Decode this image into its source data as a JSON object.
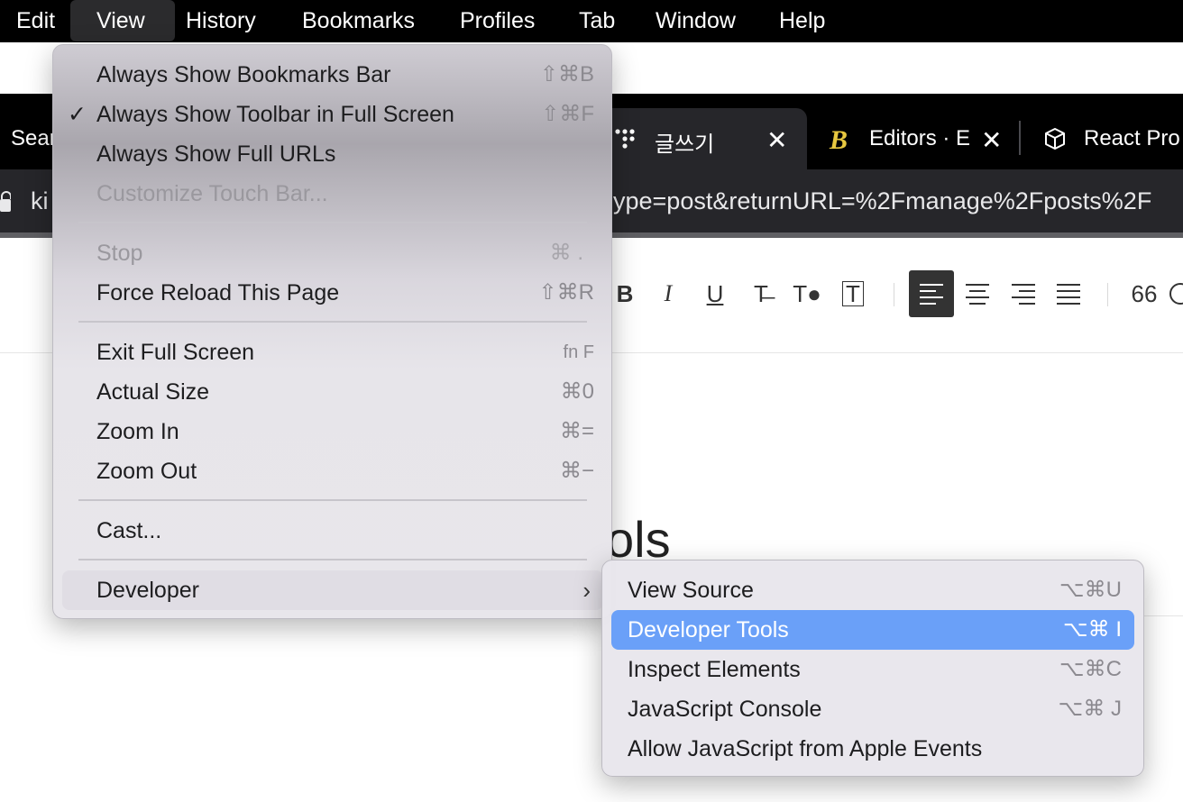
{
  "menubar": {
    "items": [
      "Edit",
      "View",
      "History",
      "Bookmarks",
      "Profiles",
      "Tab",
      "Window",
      "Help"
    ],
    "active": "View"
  },
  "tabs": {
    "left_partial": "Sear",
    "active_label": "글쓰기",
    "editors_label": "Editors · E",
    "react_label": "React Pro",
    "close_glyph": "✕"
  },
  "url": {
    "left_partial": "ki",
    "right_partial": "ype=post&returnURL=%2Fmanage%2Fposts%2F"
  },
  "editor": {
    "toolbar": [
      "B",
      "I",
      "U",
      "T̶",
      "T●",
      "T",
      "≡",
      "≡",
      "≡",
      "≡",
      "66"
    ],
    "title_partial": "ols"
  },
  "view_menu": {
    "always_show_bookmarks_bar": {
      "label": "Always Show Bookmarks Bar",
      "shortcut": "⇧⌘B"
    },
    "always_show_toolbar": {
      "label": "Always Show Toolbar in Full Screen",
      "shortcut": "⇧⌘F",
      "checked": "✓"
    },
    "always_show_full_urls": {
      "label": "Always Show Full URLs",
      "shortcut": ""
    },
    "customize_touch_bar": {
      "label": "Customize Touch Bar...",
      "shortcut": ""
    },
    "stop": {
      "label": "Stop",
      "shortcut": "⌘ ."
    },
    "force_reload": {
      "label": "Force Reload This Page",
      "shortcut": "⇧⌘R"
    },
    "exit_full_screen": {
      "label": "Exit Full Screen",
      "shortcut": "fn F"
    },
    "actual_size": {
      "label": "Actual Size",
      "shortcut": "⌘0"
    },
    "zoom_in": {
      "label": "Zoom In",
      "shortcut": "⌘="
    },
    "zoom_out": {
      "label": "Zoom Out",
      "shortcut": "⌘−"
    },
    "cast": {
      "label": "Cast...",
      "shortcut": ""
    },
    "developer": {
      "label": "Developer",
      "chevron": "›"
    }
  },
  "developer_menu": {
    "view_source": {
      "label": "View Source",
      "shortcut": "⌥⌘U"
    },
    "developer_tools": {
      "label": "Developer Tools",
      "shortcut": "⌥⌘ I"
    },
    "inspect_elements": {
      "label": "Inspect Elements",
      "shortcut": "⌥⌘C"
    },
    "javascript_console": {
      "label": "JavaScript Console",
      "shortcut": "⌥⌘ J"
    },
    "allow_js_apple_events": {
      "label": "Allow JavaScript from Apple Events",
      "shortcut": ""
    }
  },
  "colors": {
    "menubar_bg": "#000000",
    "selection_blue": "#6aa0f8",
    "menu_bg": "#e8e6eb",
    "tab_bg": "#26262a",
    "editors_logo": "#e8c840"
  },
  "icons": [
    "lock-icon",
    "grid-dots-icon",
    "bootstrap-logo-icon",
    "cube-icon",
    "checkmark-icon",
    "chevron-right-icon"
  ]
}
